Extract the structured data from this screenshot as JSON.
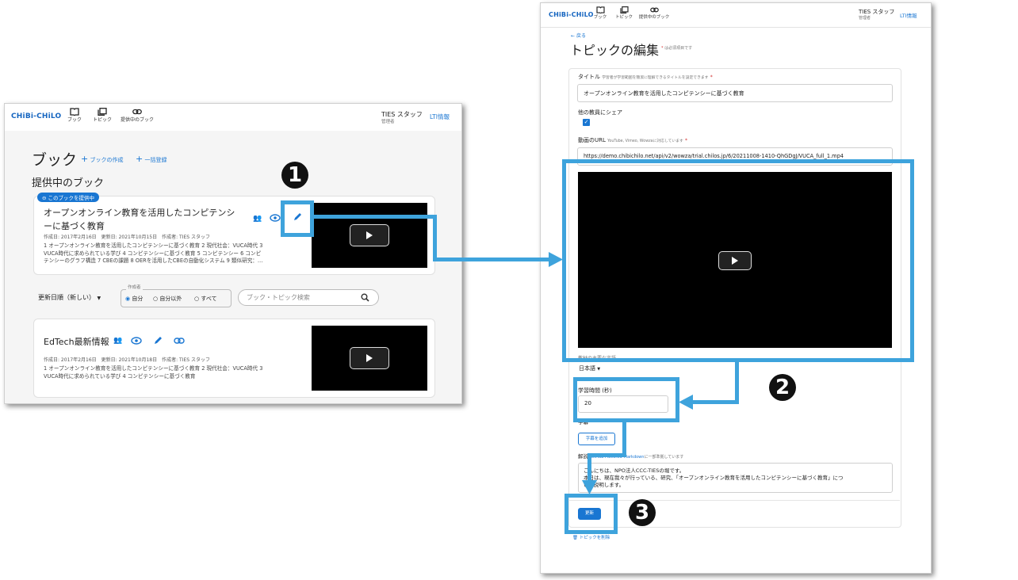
{
  "left": {
    "logo": "CHiBi-CHiLO",
    "nav": {
      "book": "ブック",
      "topic": "トピック",
      "provided": "提供中のブック"
    },
    "user": {
      "name": "TIES スタッフ",
      "role": "管理者"
    },
    "lti": "LTI情報",
    "page_title": "ブック",
    "create_book": "ブックの作成",
    "bulk_register": "一括登録",
    "section_title": "提供中のブック",
    "providing_badge": "このブックを提供中",
    "book1": {
      "title_line1": "オープンオンライン教育を活用したコンピテンシ",
      "title_line2": "ーに基づく教育",
      "meta": "作成日: 2017年2月16日　更新日: 2021年10月15日　作成者: TIES スタッフ",
      "desc1": "1 オープンオンライン教育を活用したコンピテンシーに基づく教育 2 現代社会：VUCA時代 3",
      "desc2": "VUCA時代に求められている学び 4 コンピテンシーに基づく教育 5 コンピテンシー 6 コンピ",
      "desc3": "テンシーのグラフ構造 7 CBEの課題 8 OERを活用したCBEの自動化システム 9 類似研究：…"
    },
    "sort_label": "更新日順（新しい）",
    "author_legend": "作成者",
    "radio_self": "自分",
    "radio_others": "自分以外",
    "radio_all": "すべて",
    "search_placeholder": "ブック・トピック検索",
    "book2": {
      "title": "EdTech最新情報",
      "meta": "作成日: 2017年2月16日　更新日: 2021年10月18日　作成者: TIES スタッフ",
      "desc1": "1 オープンオンライン教育を活用したコンピテンシーに基づく教育 2 現代社会：VUCA時代 3",
      "desc2": "VUCA時代に求められている学び 4 コンピテンシーに基づく教育"
    }
  },
  "right": {
    "logo": "CHiBi-CHiLO",
    "nav": {
      "book": "ブック",
      "topic": "トピック",
      "provided": "提供中のブック"
    },
    "user": {
      "name": "TIES スタッフ",
      "role": "管理者"
    },
    "lti": "LTI情報",
    "back": "戻る",
    "page_title": "トピックの編集",
    "required_note": "は必須項目です",
    "title_label": "タイトル",
    "title_help": "学習者が学習範囲を簡潔に理解できるタイトルを設定できます",
    "title_value": "オープンオンライン教育を活用したコンピテンシーに基づく教育",
    "share_label": "他の教員にシェア",
    "video_url_label": "動画のURL",
    "video_url_help": "YouTube, Vimeo, Wowzaに対応しています",
    "video_url_value": "https://demo.chibichilo.net/api/v2/wowza/trial.chilos.jp/6/20211008-1410-QhGDgJ/VUCA_full_1.mp4",
    "language_label": "教材の主要な言語",
    "language_value": "日本語",
    "duration_label": "学習時間 (秒)",
    "duration_value": "20",
    "subtitle_label": "字幕",
    "add_subtitle": "字幕を追加",
    "desc_label": "解説",
    "desc_help_link1": "GitHub Flavored",
    "desc_help_link2": "Markdown",
    "desc_help_rest": "に一部準拠しています",
    "desc_line1": "こんにちは、NPO法人CCC-TIESの堀です。",
    "desc_line2": "本日は、現在我々が行っている、研究、「オープンオンライン教育を活用したコンピテンシーに基づく教育」につ",
    "desc_line3": "いて説明します。",
    "update_button": "更新",
    "delete_topic": "トピックを削除"
  },
  "annotations": {
    "n1": "1",
    "n2": "2",
    "n3": "3"
  },
  "colors": {
    "accent": "#1976d2",
    "highlight": "#3ea3dc",
    "logo": "#1565c0"
  }
}
